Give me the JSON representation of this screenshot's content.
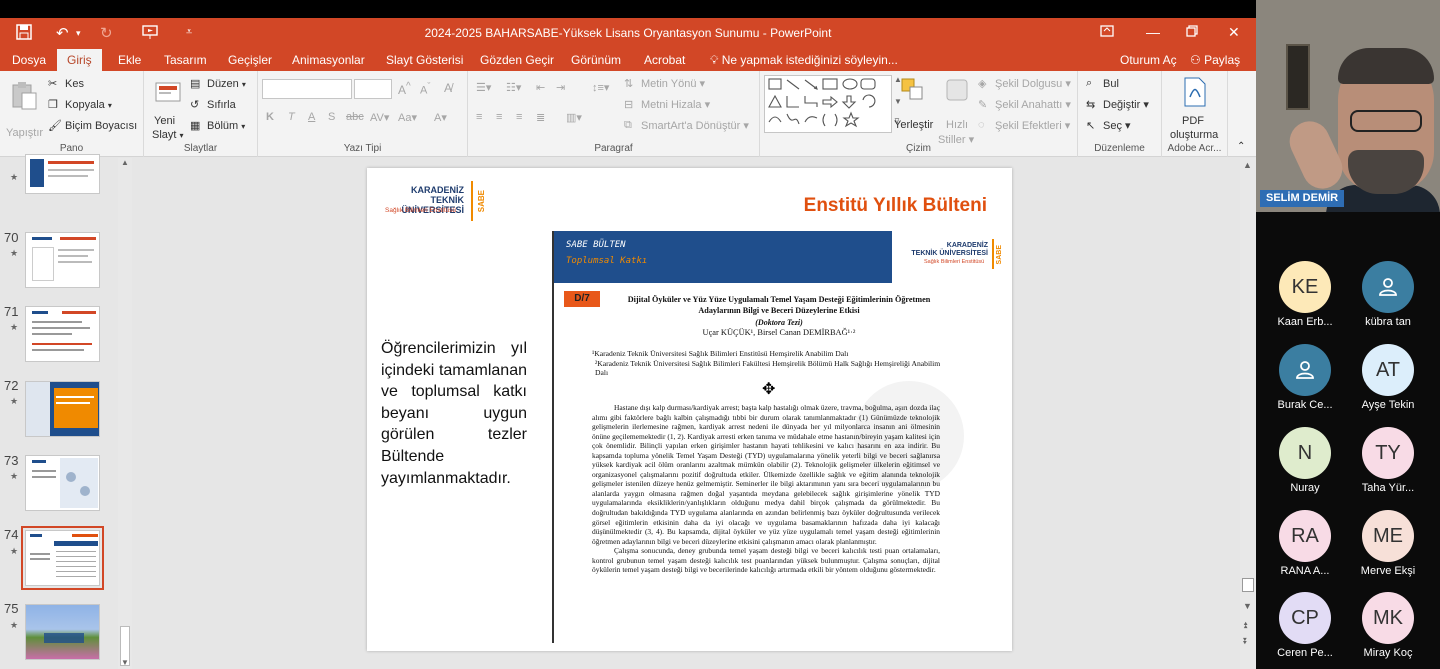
{
  "window": {
    "title": "2024-2025 BAHARSABE-Yüksek Lisans Oryantasyon Sunumu - PowerPoint"
  },
  "tabs": [
    {
      "label": "Dosya",
      "active": false
    },
    {
      "label": "Giriş",
      "active": true
    },
    {
      "label": "Ekle",
      "active": false
    },
    {
      "label": "Tasarım",
      "active": false
    },
    {
      "label": "Geçişler",
      "active": false
    },
    {
      "label": "Animasyonlar",
      "active": false
    },
    {
      "label": "Slayt Gösterisi",
      "active": false
    },
    {
      "label": "Gözden Geçir",
      "active": false
    },
    {
      "label": "Görünüm",
      "active": false
    },
    {
      "label": "Acrobat",
      "active": false
    }
  ],
  "tell_me": "Ne yapmak istediğinizi söyleyin...",
  "signin": "Oturum Aç",
  "share": "Paylaş",
  "ribbon": {
    "clipboard": {
      "paste": "Yapıştır",
      "cut": "Kes",
      "copy": "Kopyala",
      "painter": "Biçim Boyacısı",
      "label": "Pano"
    },
    "slides": {
      "new_slide_1": "Yeni",
      "new_slide_2": "Slayt",
      "layout": "Düzen",
      "reset": "Sıfırla",
      "section": "Bölüm",
      "label": "Slaytlar"
    },
    "font": {
      "label": "Yazı Tipi"
    },
    "paragraph": {
      "text_direction": "Metin Yönü",
      "align_text": "Metni Hizala",
      "smartart": "SmartArt'a Dönüştür",
      "label": "Paragraf"
    },
    "drawing": {
      "arrange": "Yerleştir",
      "quick_styles_1": "Hızlı",
      "quick_styles_2": "Stiller",
      "fill": "Şekil Dolgusu",
      "outline": "Şekil Anahattı",
      "effects": "Şekil Efektleri",
      "label": "Çizim"
    },
    "editing": {
      "find": "Bul",
      "replace": "Değiştir",
      "select": "Seç",
      "label": "Düzenleme"
    },
    "acrobat": {
      "pdf_1": "PDF",
      "pdf_2": "oluşturma",
      "label": "Adobe Acr..."
    }
  },
  "thumbnails": [
    {
      "num": "",
      "star": true
    },
    {
      "num": "70",
      "star": true
    },
    {
      "num": "71",
      "star": true
    },
    {
      "num": "72",
      "star": true
    },
    {
      "num": "73",
      "star": true
    },
    {
      "num": "74",
      "star": true,
      "selected": true
    },
    {
      "num": "75",
      "star": true
    }
  ],
  "slide": {
    "logo_line1": "KARADENİZ",
    "logo_line2": "TEKNİK ÜNİVERSİTESİ",
    "logo_sub": "Sağlık Bilimleri Enstitüsü",
    "logo_sabe": "SABE",
    "title": "Enstitü Yıllık Bülteni",
    "text": "Öğrencilerimizin yıl içindeki tamamlanan ve toplumsal katkı beyanı uygun görülen tezler Bültende yayımlanmaktadır.",
    "doc": {
      "banner_1": "SABE BÜLTEN",
      "banner_2": "Toplumsal Katkı",
      "code": "D/7",
      "title": "Dijital Öyküler ve Yüz Yüze Uygulamalı Temel Yaşam Desteği Eğitimlerinin Öğretmen Adaylarının Bilgi ve Beceri Düzeylerine Etkisi",
      "subtitle": "(Doktora Tezi)",
      "authors": "Uçar KÜÇÜK¹, Birsel Canan DEMİRBAĞ¹·²",
      "affil_1": "¹Karadeniz Teknik Üniversitesi Sağlık Bilimleri Enstitüsü Hemşirelik Anabilim Dalı",
      "affil_2": "²Karadeniz Teknik Üniversitesi Sağlık Bilimleri Fakültesi Hemşirelik Bölümü Halk Sağlığı Hemşireliği Anabilim Dalı",
      "para_1": "Hastane dışı kalp durması/kardiyak arrest; başta kalp hastalığı olmak üzere, travma, boğulma, aşırı dozda ilaç alımı gibi faktörlere bağlı kalbin çalışmadığı tıbbi bir durum olarak tanımlanmaktadır (1) Günümüzde teknolojik gelişmelerin ilerlemesine rağmen, kardiyak arrest nedeni ile dünyada her yıl milyonlarca insanın ani ölmesinin önüne geçilememektedir (1, 2). Kardiyak arresti erken tanıma ve müdahale etme hastanın/bireyin yaşam kalitesi için çok önemlidir. Bilinçli yapılan erken girişimler hastanın hayati tehlikesini ve kalıcı hasarını en aza indirir. Bu kapsamda topluma yönelik Temel Yaşam Desteği (TYD) uygulamalarına yönelik yeterli bilgi ve beceri sağlanırsa yüksek kardiyak acil ölüm oranlarını azaltmak mümkün olabilir (2). Teknolojik gelişmeler ülkelerin eğitimsel ve organizasyonel çalışmalarını pozitif doğrultuda etkiler. Ülkemizde özellikle sağlık ve eğitim alanında teknolojik gelişmeler istenilen düzeye henüz gelmemiştir. Seminerler ile bilgi aktarımının yanı sıra beceri uygulamalarının bu alanlarda yaygın olmasına rağmen doğal yaşantıda meydana gelebilecek sağlık girişimlerine yönelik TYD uygulamalarında eksikliklerin/yanlışlıkların olduğunu medya dahil birçok çalışmada da görülmektedir. Bu doğrultudan bakıldığında TYD uygulama alanlarında en azından belirlenmiş bazı öyküler doğrultusunda verilecek görsel eğitimlerin etkisinin daha da iyi olacağı ve uygulama basamaklarının hafızada daha iyi kalacağı düşünülmektedir (3, 4). Bu kapsamda, dijital öyküler ve yüz yüze uygulamalı temel yaşam desteği eğitimlerinin öğretmen adaylarının bilgi ve beceri düzeylerine etkisini çalışmanın amacı olarak planlanmıştır.",
      "para_2": "Çalışma sonucunda, deney grubunda temel yaşam desteği bilgi ve beceri kalıcılık testi puan ortalamaları, kontrol grubunun temel yaşam desteği kalıcılık test puanlarından yüksek bulunmuştur. Çalışma sonuçları, dijital öykülerin temel yaşam desteği bilgi ve becerilerinde kalıcılığı artırmada etkili bir yöntem olduğunu göstermektedir."
    }
  },
  "meeting": {
    "presenter": "SELİM DEMİR",
    "participants": [
      {
        "initials": "KE",
        "name": "Kaan Erb...",
        "color": "#fde9b8"
      },
      {
        "initials": "",
        "name": "kübra tan",
        "color": "#3b7ea1",
        "icon": "person-icon"
      },
      {
        "initials": "",
        "name": "Burak Ce...",
        "color": "#3b7ea1",
        "icon": "person-icon"
      },
      {
        "initials": "AT",
        "name": "Ayşe Tekin",
        "color": "#dceefb"
      },
      {
        "initials": "N",
        "name": "Nuray",
        "color": "#dfeccd"
      },
      {
        "initials": "TY",
        "name": "Taha Yür...",
        "color": "#f8dbe6"
      },
      {
        "initials": "RA",
        "name": "RANA A...",
        "color": "#f8dbe6"
      },
      {
        "initials": "ME",
        "name": "Merve Ekşi",
        "color": "#f7e0d8"
      },
      {
        "initials": "CP",
        "name": "Ceren Pe...",
        "color": "#e2dcf5"
      },
      {
        "initials": "MK",
        "name": "Miray Koç",
        "color": "#f8dbe6"
      }
    ]
  },
  "colors": {
    "accent": "#d24726",
    "slide_title": "#e0500f",
    "banner": "#1f4e8c"
  }
}
